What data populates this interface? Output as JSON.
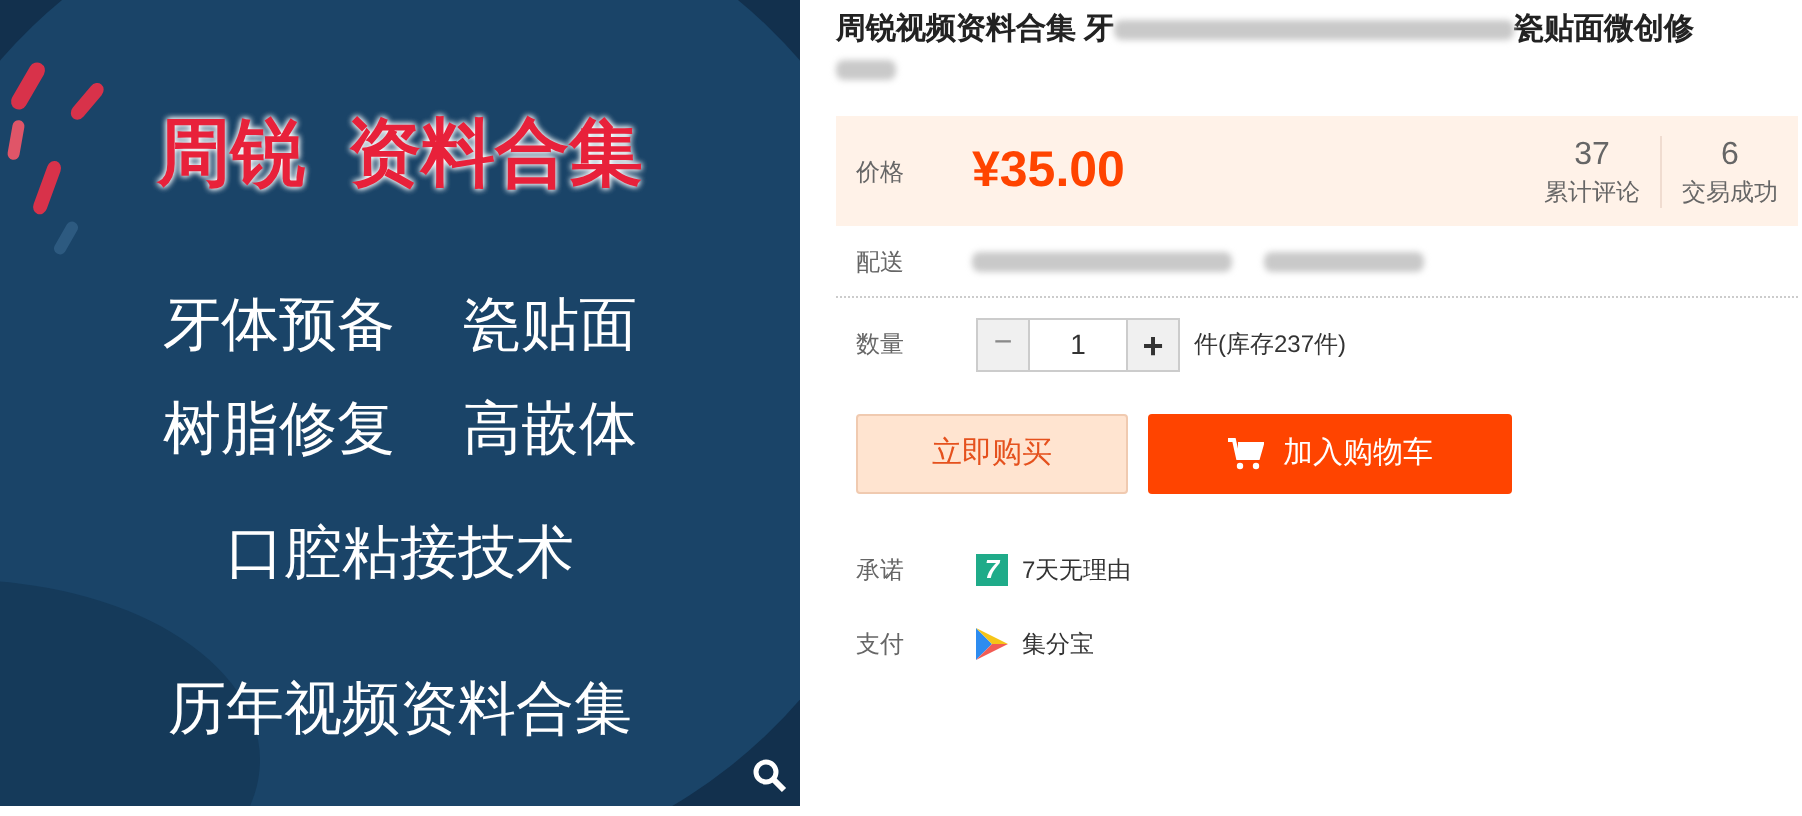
{
  "product_image": {
    "headline": "周锐  资料合集",
    "lines": [
      [
        "牙体预备",
        "瓷贴面"
      ],
      [
        "树脂修复",
        "高嵌体"
      ],
      [
        "口腔粘接技术"
      ]
    ],
    "footer": "历年视频资料合集"
  },
  "title": {
    "before": "周锐视频资料合集 牙",
    "after": "瓷贴面微创修"
  },
  "price": {
    "label": "价格",
    "value": "¥35.00",
    "stats": [
      {
        "value": "37",
        "label": "累计评论"
      },
      {
        "value": "6",
        "label": "交易成功"
      }
    ]
  },
  "delivery": {
    "label": "配送"
  },
  "quantity": {
    "label": "数量",
    "minus": "−",
    "value": "1",
    "plus": "+",
    "minus_disabled": true,
    "stock": "件(库存237件)"
  },
  "buttons": {
    "buy_now": "立即购买",
    "add_to_cart": "加入购物车"
  },
  "services": [
    {
      "kind": "promise",
      "label": "承诺",
      "text": "7天无理由",
      "badge": "7"
    },
    {
      "kind": "payment",
      "label": "支付",
      "text": "集分宝"
    }
  ]
}
